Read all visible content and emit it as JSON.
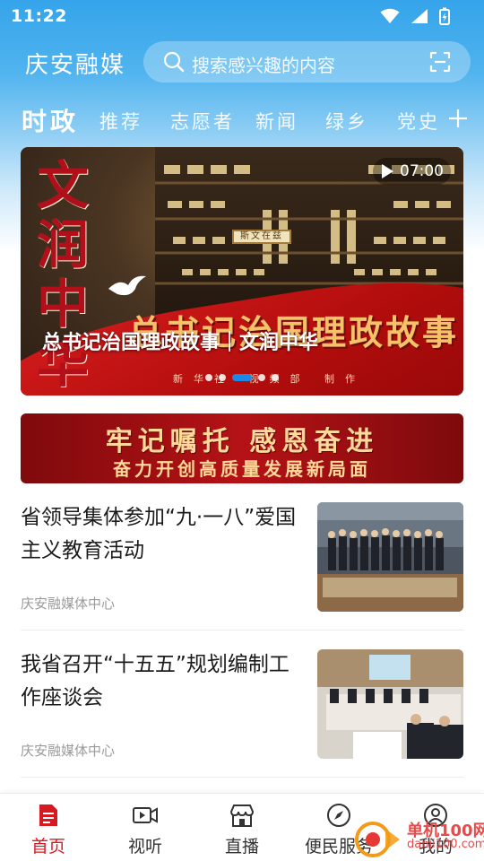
{
  "status_bar": {
    "time": "11:22"
  },
  "header": {
    "app_title": "庆安融媒",
    "search_placeholder": "搜索感兴趣的内容"
  },
  "tabs": [
    {
      "label": "时政",
      "active": true
    },
    {
      "label": "推荐",
      "active": false
    },
    {
      "label": "志愿者",
      "active": false
    },
    {
      "label": "新闻",
      "active": false
    },
    {
      "label": "绿乡",
      "active": false
    },
    {
      "label": "党史",
      "active": false
    }
  ],
  "banner": {
    "duration": "07:00",
    "caption": "总书记治国理政故事｜文润中华",
    "art_calligraphy": "文润中华",
    "art_headline": "总书记治国理政故事",
    "art_credit": "新华社 视频部 制作",
    "art_sign": "斯文在兹",
    "slide_count": 5,
    "active_slide": 2
  },
  "promo": {
    "line1": "牢记嘱托 感恩奋进",
    "line2": "奋力开创高质量发展新局面"
  },
  "news": [
    {
      "title": "省领导集体参加“九·一八”爱国主义教育活动",
      "source": "庆安融媒体中心"
    },
    {
      "title": "我省召开“十五五”规划编制工作座谈会",
      "source": "庆安融媒体中心"
    }
  ],
  "bottom_nav": [
    {
      "label": "首页",
      "icon": "home-doc-icon",
      "active": true
    },
    {
      "label": "视听",
      "icon": "video-icon",
      "active": false
    },
    {
      "label": "直播",
      "icon": "live-store-icon",
      "active": false
    },
    {
      "label": "便民服务",
      "icon": "compass-icon",
      "active": false
    },
    {
      "label": "我的",
      "icon": "user-icon",
      "active": false
    }
  ],
  "watermark": {
    "text": "单机100网",
    "url": "danji100.com"
  },
  "colors": {
    "accent_red": "#d71920",
    "header_blue": "#35a4ea",
    "dot_active": "#1e88e5"
  }
}
